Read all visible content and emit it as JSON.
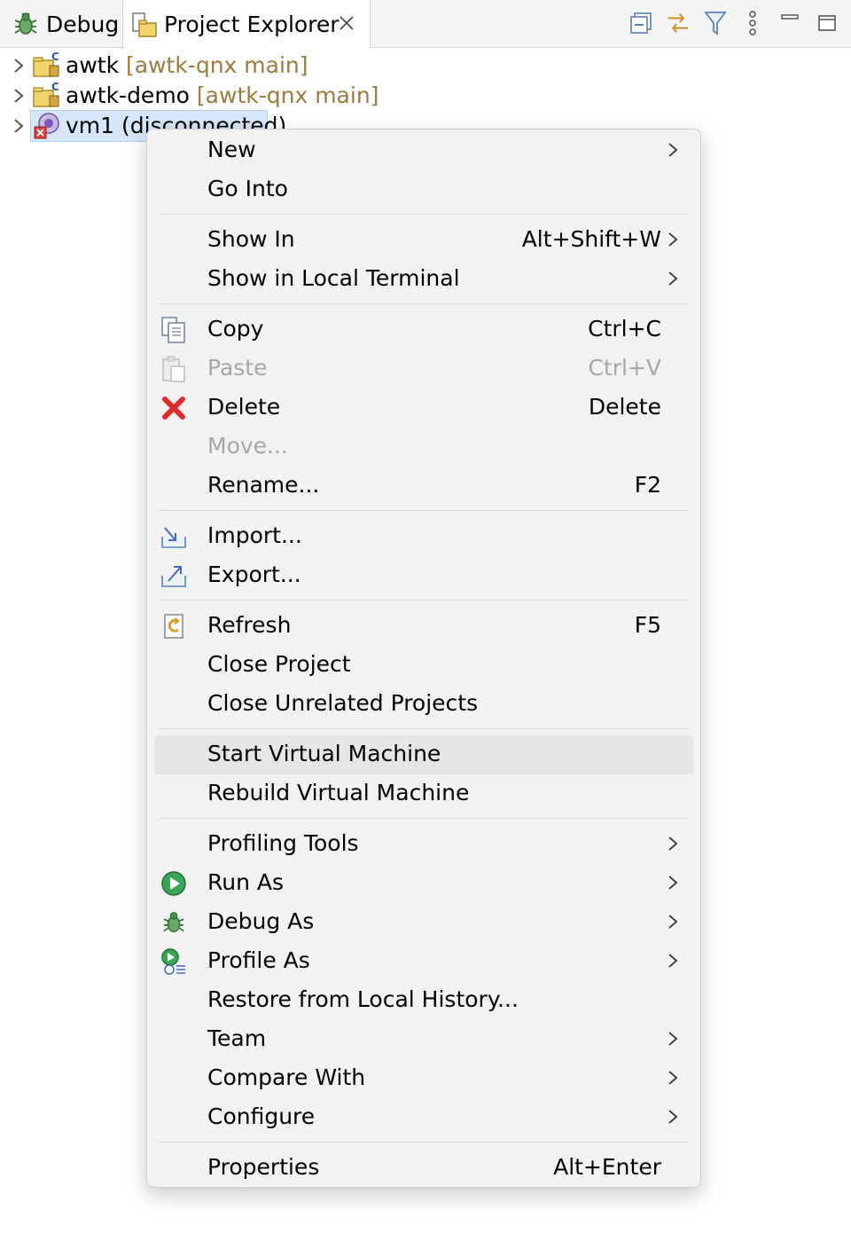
{
  "tabs": {
    "debug": "Debug",
    "project_explorer": "Project Explorer"
  },
  "toolbar": {
    "icons": [
      "collapse-all-icon",
      "link-with-editor-icon",
      "filter-icon",
      "view-menu-icon",
      "minimize-icon",
      "maximize-icon"
    ]
  },
  "tree": {
    "items": [
      {
        "name": "awtk",
        "repo": "[awtk-qnx main]"
      },
      {
        "name": "awtk-demo",
        "repo": "[awtk-qnx main]"
      },
      {
        "name": "vm1 (disconnected)",
        "repo": ""
      }
    ]
  },
  "menu": {
    "new": "New",
    "go_into": "Go Into",
    "show_in": "Show In",
    "show_in_acc": "Alt+Shift+W",
    "show_local_terminal": "Show in Local Terminal",
    "copy": "Copy",
    "copy_acc": "Ctrl+C",
    "paste": "Paste",
    "paste_acc": "Ctrl+V",
    "delete": "Delete",
    "delete_acc": "Delete",
    "move": "Move...",
    "rename": "Rename...",
    "rename_acc": "F2",
    "import": "Import...",
    "export": "Export...",
    "refresh": "Refresh",
    "refresh_acc": "F5",
    "close_project": "Close Project",
    "close_unrelated": "Close Unrelated Projects",
    "start_vm": "Start Virtual Machine",
    "rebuild_vm": "Rebuild Virtual Machine",
    "profiling_tools": "Profiling Tools",
    "run_as": "Run As",
    "debug_as": "Debug As",
    "profile_as": "Profile As",
    "restore_history": "Restore from Local History...",
    "team": "Team",
    "compare_with": "Compare With",
    "configure": "Configure",
    "properties": "Properties",
    "properties_acc": "Alt+Enter"
  },
  "colors": {
    "repo_text": "#9c7b3c",
    "selection": "#d6e7fb",
    "menu_bg": "#f2f2f2",
    "disabled_text": "#a6a6a6"
  }
}
